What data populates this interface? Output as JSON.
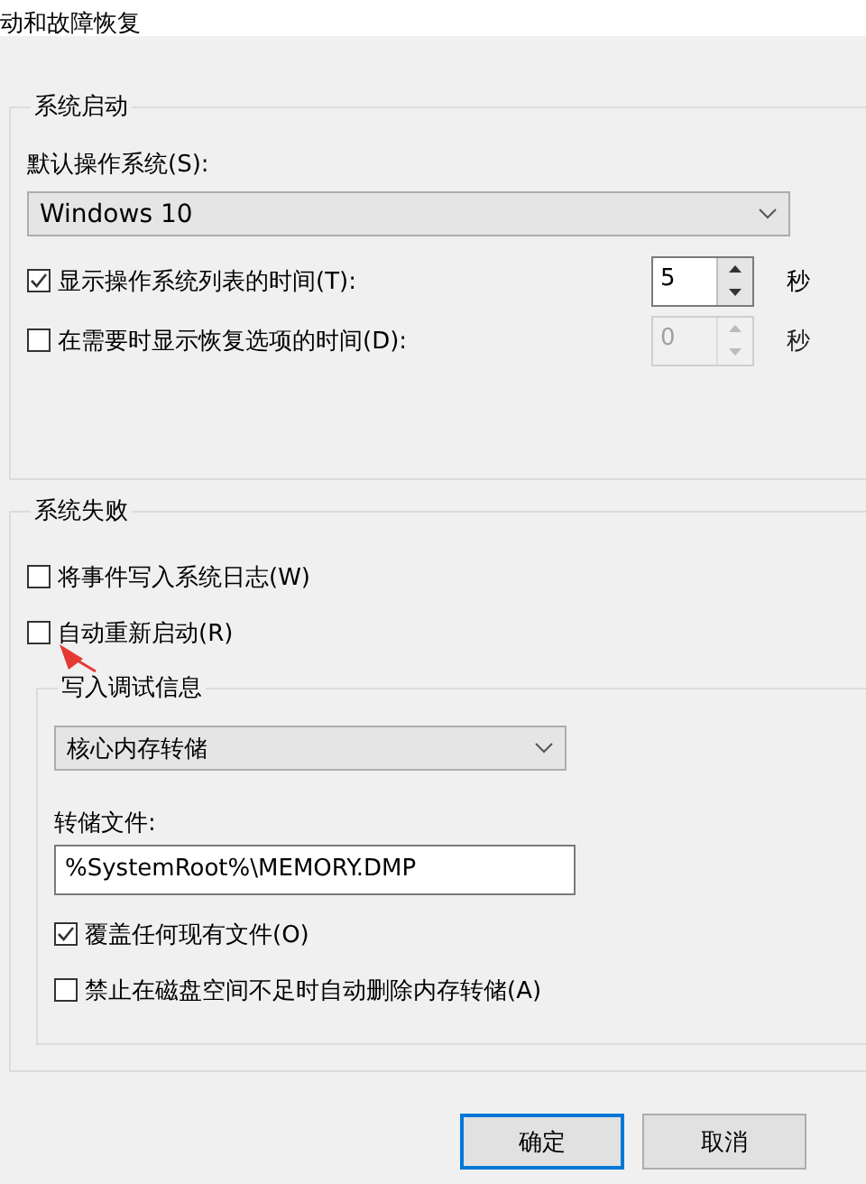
{
  "window": {
    "title": "动和故障恢复"
  },
  "system_startup": {
    "title": "系统启动",
    "default_os_label": "默认操作系统(S):",
    "default_os": "Windows 10",
    "rows": [
      {
        "label": "显示操作系统列表的时间(T):",
        "checked": true,
        "value": "5",
        "unit": "秒",
        "disabled": false
      },
      {
        "label": "在需要时显示恢复选项的时间(D):",
        "checked": false,
        "value": "0",
        "unit": "秒",
        "disabled": true
      }
    ]
  },
  "system_failure": {
    "title": "系统失败",
    "options": [
      {
        "label": "将事件写入系统日志(W)",
        "checked": false
      },
      {
        "label": "自动重新启动(R)",
        "checked": false
      }
    ],
    "debug": {
      "title": "写入调试信息",
      "dump_type": "核心内存转储",
      "dump_file_label": "转储文件:",
      "dump_file": "%SystemRoot%\\MEMORY.DMP",
      "options": [
        {
          "label": "覆盖任何现有文件(O)",
          "checked": true
        },
        {
          "label": "禁止在磁盘空间不足时自动删除内存转储(A)",
          "checked": false
        }
      ]
    }
  },
  "buttons": [
    {
      "label": "确定",
      "default": true
    },
    {
      "label": "取消",
      "default": false
    }
  ]
}
